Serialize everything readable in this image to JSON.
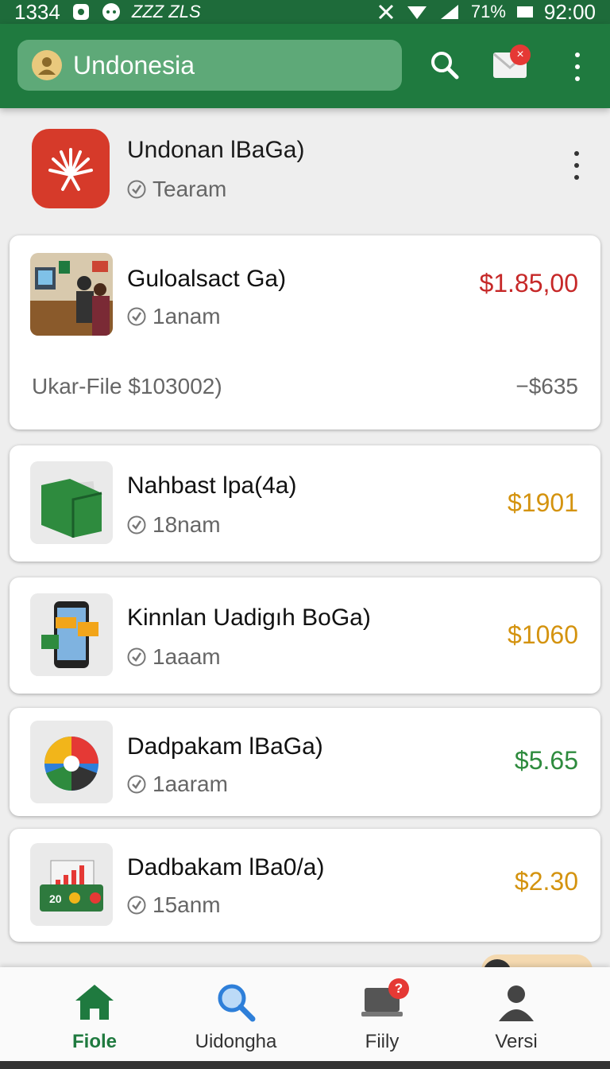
{
  "status_bar": {
    "left_text": "1334",
    "carrier": "ZZZ ZLS",
    "battery": "71%",
    "time": "92:00"
  },
  "app_bar": {
    "search_text": "Undonesia",
    "mail_badge": "×"
  },
  "account": {
    "title": "Undonan lBaGa)",
    "subtitle": "Tearam"
  },
  "cards": [
    {
      "title": "Guloalsact Ga)",
      "subtitle": "1anam",
      "amount": "$1.85,00",
      "amount_color": "#c62828",
      "footer_left": "Ukar-File $103002)",
      "footer_right": "−$635"
    },
    {
      "title": "Nahbast lpa(4a)",
      "subtitle": "18nam",
      "amount": "$1901",
      "amount_color": "#d4930f"
    },
    {
      "title": "Kinnlan Uadigıh BoGa)",
      "subtitle": "1aaam",
      "amount": "$1060",
      "amount_color": "#d4930f"
    },
    {
      "title": "Dadpakam lBaGa)",
      "subtitle": "1aaram",
      "amount": "$5.65",
      "amount_color": "#2e8b3e"
    },
    {
      "title": "Dadbakam lBa0/a)",
      "subtitle": "15anm",
      "amount": "$2.30",
      "amount_color": "#d4930f",
      "thumb_text": "20"
    }
  ],
  "bottom_nav": {
    "items": [
      {
        "label": "Fiole",
        "active": true
      },
      {
        "label": "Uidongha"
      },
      {
        "label": "Fiily",
        "badge": "?"
      },
      {
        "label": "Versi"
      }
    ]
  },
  "colors": {
    "primary": "#1f7a3f",
    "status_bar": "#1e6b3a",
    "accent_red": "#c62828",
    "accent_orange": "#d4930f",
    "accent_green": "#2e8b3e"
  }
}
